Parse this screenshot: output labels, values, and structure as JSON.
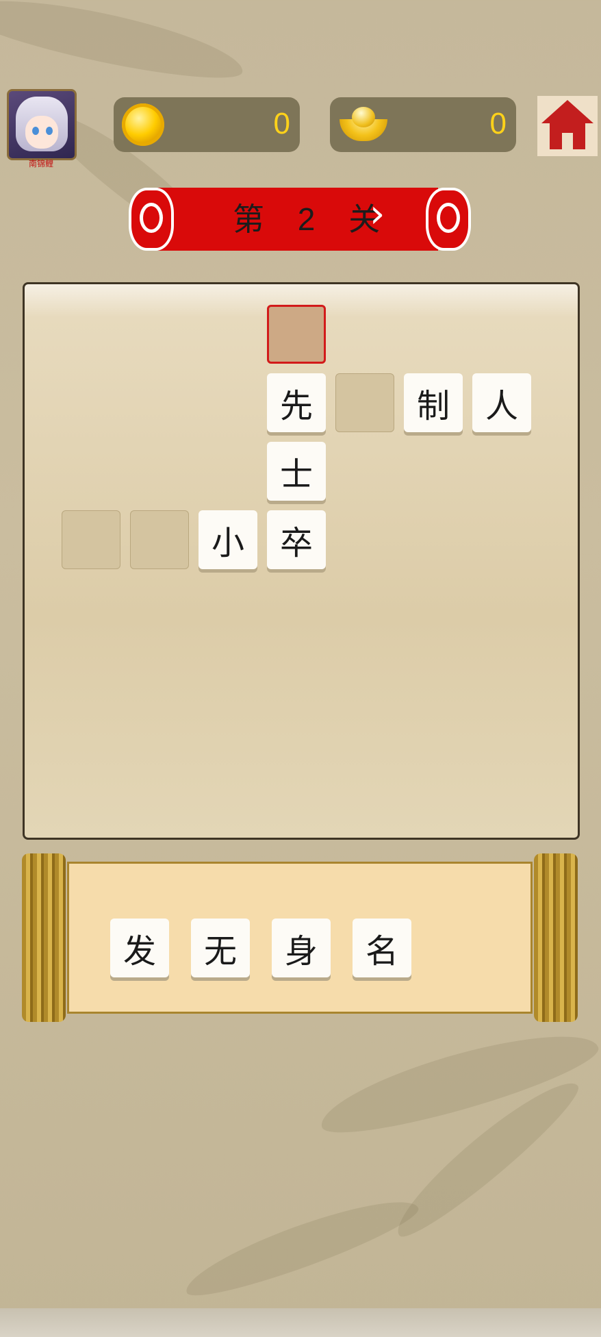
{
  "player": {
    "name": "南锦鲤"
  },
  "currency": {
    "coins": "0",
    "ingots": "0"
  },
  "level": {
    "label": "第 2 关",
    "next_arrow": "›"
  },
  "board": {
    "tiles": [
      "",
      "先",
      "",
      "制",
      "人",
      "士",
      "",
      "",
      "小",
      "卒"
    ]
  },
  "options": [
    "发",
    "无",
    "身",
    "名"
  ],
  "colors": {
    "banner": "#d90a0a",
    "gold_text": "#ffd21a",
    "active_border": "#d21a1a"
  }
}
